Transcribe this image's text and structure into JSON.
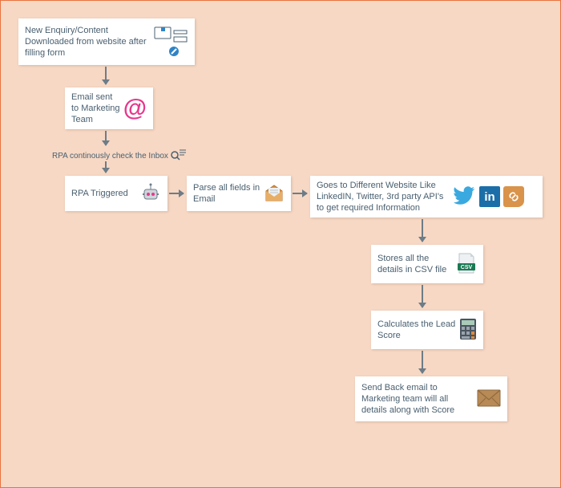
{
  "steps": {
    "enquiry": "New Enquiry/Content Downloaded from website after filling form",
    "email_sent": "Email sent to Marketing Team",
    "rpa_check": "RPA continously check the Inbox",
    "rpa_triggered": "RPA Triggered",
    "parse_fields": "Parse all fields in Email",
    "goto_sites": "Goes to Different Website Like LinkedIN, Twitter,  3rd party API's to get required Information",
    "store_csv": "Stores all the details in CSV file",
    "calc_score": "Calculates the Lead Score",
    "send_back": "Send Back email to Marketing team will all details along with Score"
  },
  "icons": {
    "form": "form-icon",
    "at": "at-icon",
    "search": "search-icon",
    "robot": "robot-icon",
    "envelope_open": "envelope-open-icon",
    "twitter": "twitter-icon",
    "linkedin": "linkedin-icon",
    "link": "link-icon",
    "csv": "csv-icon",
    "calculator": "calculator-icon",
    "envelope": "envelope-closed-icon"
  }
}
